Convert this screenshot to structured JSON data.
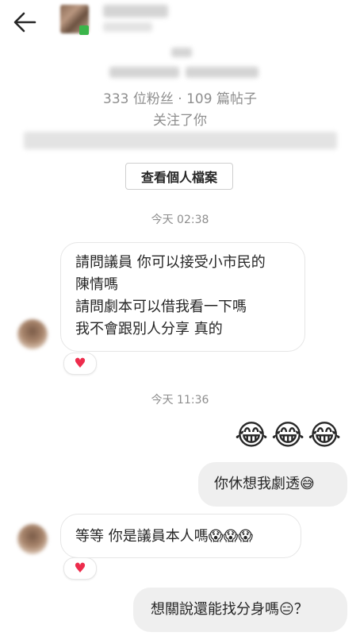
{
  "header": {
    "back_icon": "arrow-left-icon",
    "profile_stats": "333 位粉丝 · 109 篇帖子",
    "follows_you": "关注了你",
    "view_profile_button": "查看個人檔案"
  },
  "messages": [
    {
      "type": "timestamp",
      "text": "今天 02:38"
    },
    {
      "type": "incoming",
      "lines": [
        "請問議員 你可以接受小市民的",
        "陳情嗎",
        "請問劇本可以借我看一下嗎",
        "我不會跟別人分享 真的"
      ],
      "reaction": "♥"
    },
    {
      "type": "timestamp",
      "text": "今天 11:36"
    },
    {
      "type": "outgoing",
      "text": "😂😂😂"
    },
    {
      "type": "outgoing",
      "text": "你休想我劇透",
      "emoji": "😅"
    },
    {
      "type": "incoming",
      "text": "等等 你是議員本人嗎",
      "emoji": "😱😱😱",
      "reaction": "♥"
    },
    {
      "type": "outgoing",
      "text": "想關說還能找分身嗎",
      "emoji": "😑",
      "suffix": "？"
    }
  ],
  "colors": {
    "heart": "#ed2c4c",
    "meta_text": "#8e8e8e",
    "outgoing_bubble": "#efefef"
  }
}
